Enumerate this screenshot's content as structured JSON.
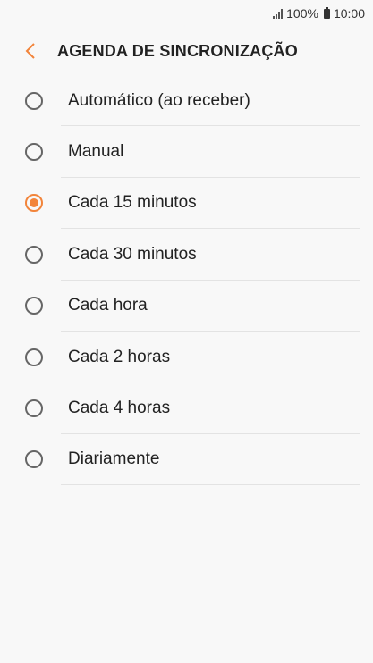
{
  "status_bar": {
    "battery": "100%",
    "time": "10:00"
  },
  "header": {
    "title": "AGENDA DE SINCRONIZAÇÃO",
    "accent_color": "#f2843a"
  },
  "options": [
    {
      "label": "Automático (ao receber)",
      "selected": false
    },
    {
      "label": "Manual",
      "selected": false
    },
    {
      "label": "Cada 15 minutos",
      "selected": true
    },
    {
      "label": "Cada 30 minutos",
      "selected": false
    },
    {
      "label": "Cada hora",
      "selected": false
    },
    {
      "label": "Cada 2 horas",
      "selected": false
    },
    {
      "label": "Cada 4 horas",
      "selected": false
    },
    {
      "label": "Diariamente",
      "selected": false
    }
  ]
}
